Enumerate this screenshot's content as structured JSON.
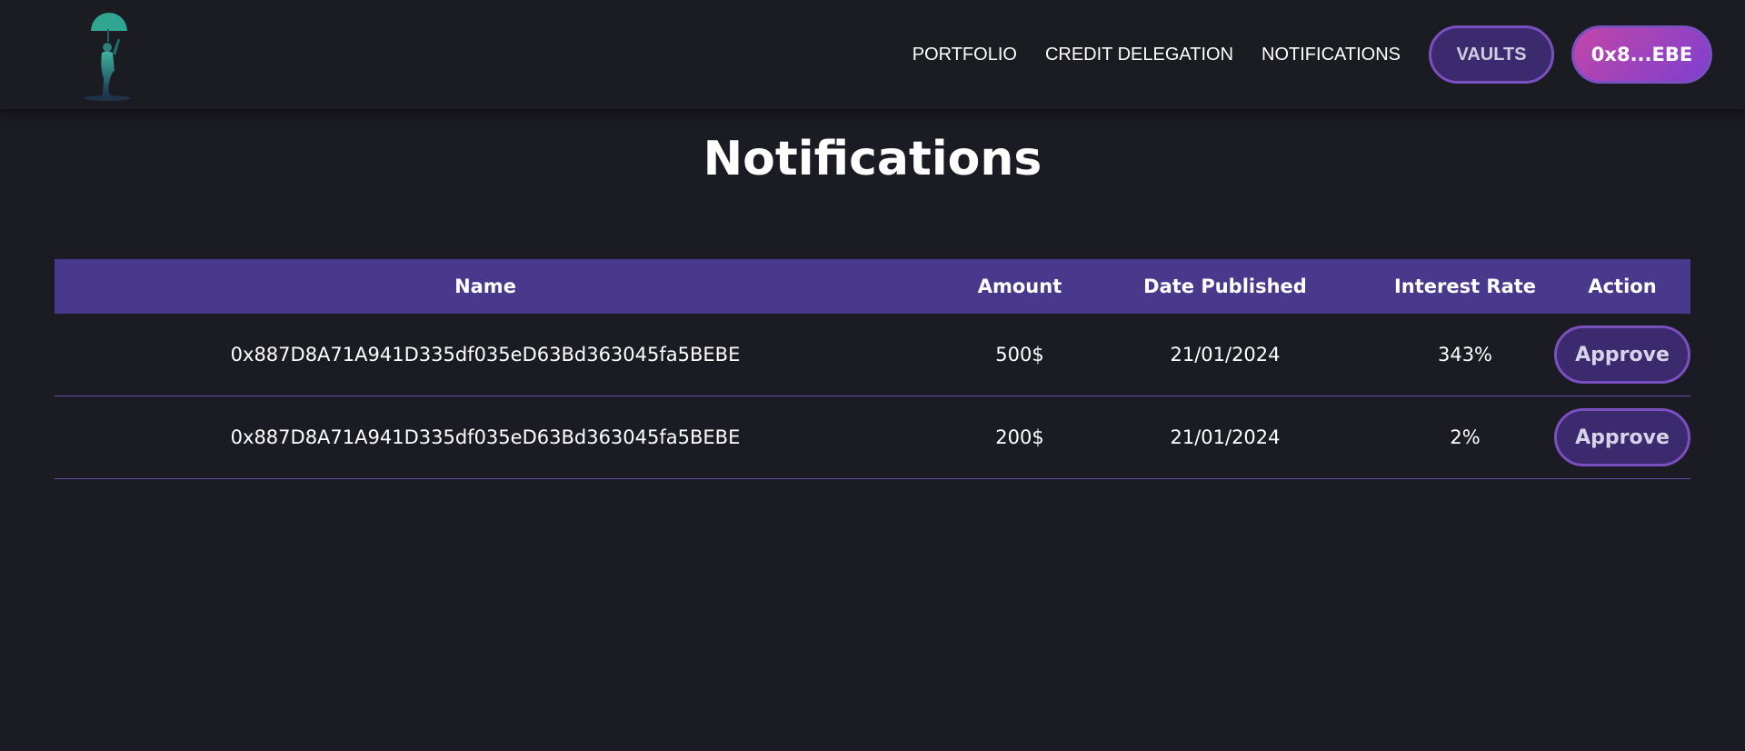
{
  "header": {
    "logo_icon": "umbrella-figure-logo-icon",
    "nav": {
      "portfolio": "PORTFOLIO",
      "credit_delegation": "CREDIT DELEGATION",
      "notifications": "NOTIFICATIONS"
    },
    "vaults_button": "VAULTS",
    "wallet_button": "0x8...EBE"
  },
  "page": {
    "title": "Notifications"
  },
  "table": {
    "columns": {
      "name": "Name",
      "amount": "Amount",
      "date": "Date Published",
      "rate": "Interest Rate",
      "action": "Action"
    },
    "rows": [
      {
        "name": "0x887D8A71A941D335df035eD63Bd363045fa5BEBE",
        "amount": "500$",
        "date": "21/01/2024",
        "rate": "343%",
        "action": "Approve"
      },
      {
        "name": "0x887D8A71A941D335df035eD63Bd363045fa5BEBE",
        "amount": "200$",
        "date": "21/01/2024",
        "rate": "2%",
        "action": "Approve"
      }
    ]
  },
  "colors": {
    "background": "#1b1b23",
    "table_header": "#49398c",
    "button_fill": "#3b2a6d",
    "button_border": "#7a4fc0",
    "wallet_gradient_start": "#c247a8",
    "wallet_gradient_end": "#7d3fcf"
  }
}
